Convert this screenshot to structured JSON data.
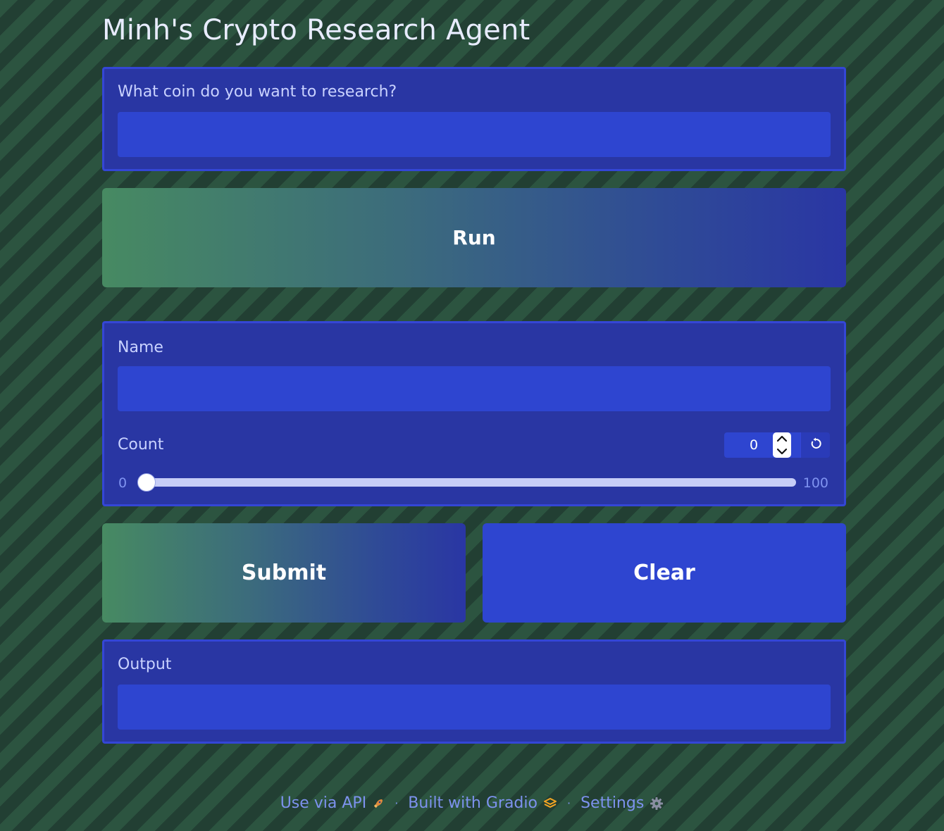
{
  "app": {
    "title": "Minh's Crypto Research Agent"
  },
  "coin_field": {
    "label": "What coin do you want to research?",
    "value": "",
    "placeholder": ""
  },
  "run_button": {
    "label": "Run"
  },
  "name_field": {
    "label": "Name",
    "value": "",
    "placeholder": ""
  },
  "count_field": {
    "label": "Count",
    "value": "0",
    "min": "0",
    "max": "100"
  },
  "actions": {
    "submit_label": "Submit",
    "clear_label": "Clear"
  },
  "output_field": {
    "label": "Output",
    "value": ""
  },
  "footer": {
    "api_label": "Use via API",
    "built_label": "Built with Gradio",
    "settings_label": "Settings",
    "separator": "·"
  },
  "icons": {
    "api": "rocket-icon",
    "gradio": "gradio-logo-icon",
    "settings": "gear-icon",
    "reset": "reset-icon",
    "spinner_up": "chevron-up-icon",
    "spinner_down": "chevron-down-icon"
  },
  "colors": {
    "background": "#25473a",
    "panel": "#2936a3",
    "panel_border": "#3446d6",
    "input": "#2e45d0",
    "label": "#c9d2ff",
    "footer_link": "#7d92ee"
  }
}
